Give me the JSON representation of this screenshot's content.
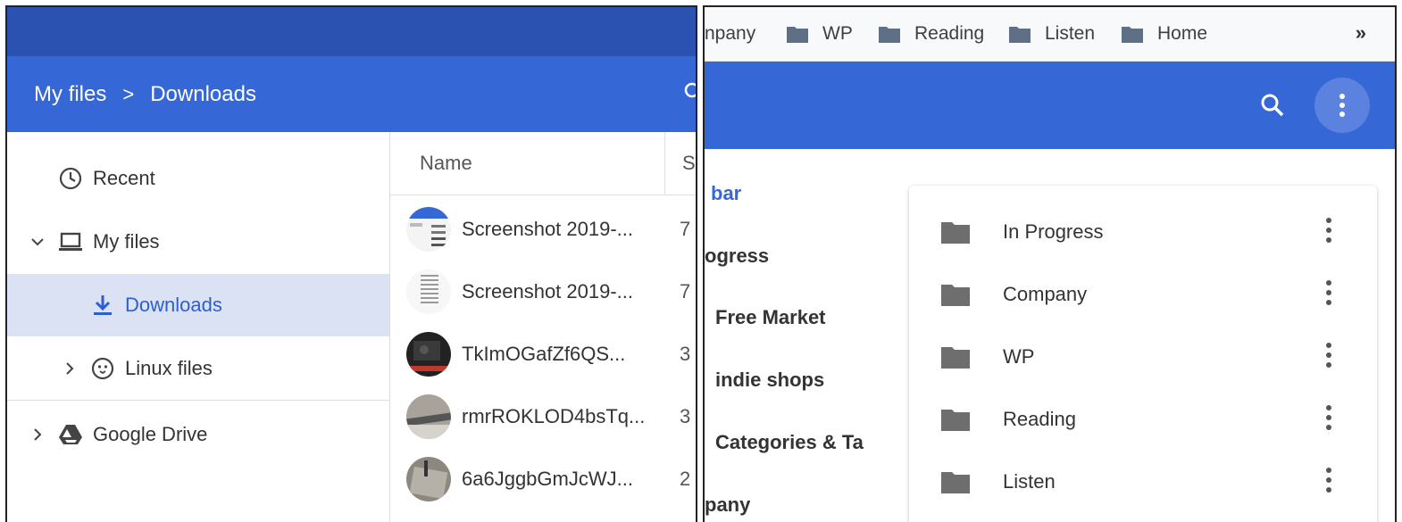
{
  "left_panel": {
    "breadcrumb": {
      "root": "My files",
      "separator": ">",
      "current": "Downloads"
    },
    "sidebar": {
      "items": [
        {
          "label": "Recent",
          "icon": "clock-icon"
        },
        {
          "label": "My files",
          "icon": "laptop-icon",
          "expanded": true
        },
        {
          "label": "Downloads",
          "icon": "download-icon",
          "selected": true
        },
        {
          "label": "Linux files",
          "icon": "penguin-icon"
        },
        {
          "label": "Google Drive",
          "icon": "drive-icon"
        }
      ]
    },
    "file_list": {
      "columns": {
        "name": "Name",
        "size": "S"
      },
      "files": [
        {
          "name": "Screenshot 2019-...",
          "size": "7"
        },
        {
          "name": "Screenshot 2019-...",
          "size": "7"
        },
        {
          "name": "TkImOGafZf6QS...",
          "size": "3"
        },
        {
          "name": "rmrROKLOD4bsTq...",
          "size": "3"
        },
        {
          "name": "6a6JggbGmJcWJ...",
          "size": "2"
        }
      ]
    },
    "colors": {
      "topbar": "#2b52b1",
      "header": "#3567d6",
      "selected_bg": "#dbe2f3",
      "accent": "#2d5fd0"
    }
  },
  "right_panel": {
    "bookmarks": [
      {
        "label": "npany"
      },
      {
        "label": "WP",
        "icon": "folder-icon"
      },
      {
        "label": "Reading",
        "icon": "folder-icon"
      },
      {
        "label": "Listen",
        "icon": "folder-icon"
      },
      {
        "label": "Home",
        "icon": "folder-icon"
      }
    ],
    "overflow": "»",
    "side_links": [
      {
        "label": "bar",
        "active": true
      },
      {
        "label": "ogress"
      },
      {
        "label": "Free Market"
      },
      {
        "label": "indie shops"
      },
      {
        "label": "Categories & Ta"
      },
      {
        "label": "pany"
      }
    ],
    "folders": [
      {
        "label": "In Progress"
      },
      {
        "label": "Company"
      },
      {
        "label": "WP"
      },
      {
        "label": "Reading"
      },
      {
        "label": "Listen"
      }
    ],
    "colors": {
      "header": "#3567d6",
      "menu_button": "#5a82de",
      "folder": "#6e6e6e"
    }
  }
}
